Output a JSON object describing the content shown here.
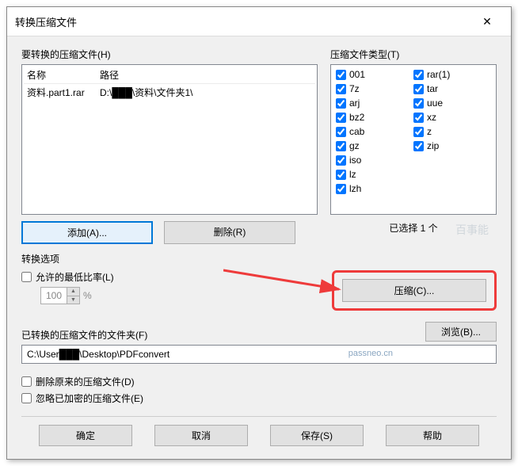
{
  "title": "转换压缩文件",
  "filesSection": {
    "label": "要转换的压缩文件(H)",
    "colName": "名称",
    "colPath": "路径",
    "row": {
      "name": "资料.part1.rar",
      "path": "D:\\███\\资料\\文件夹1\\"
    }
  },
  "typesSection": {
    "label": "压缩文件类型(T)",
    "col1": [
      "001",
      "7z",
      "arj",
      "bz2",
      "cab",
      "gz",
      "iso",
      "lz",
      "lzh"
    ],
    "col2": [
      "rar(1)",
      "tar",
      "uue",
      "xz",
      "z",
      "zip"
    ],
    "selectedNote": "已选择 1 个"
  },
  "buttons": {
    "add": "添加(A)...",
    "delete": "删除(R)",
    "compress": "压缩(C)...",
    "browse": "浏览(B)...",
    "ok": "确定",
    "cancel": "取消",
    "save": "保存(S)",
    "help": "帮助"
  },
  "options": {
    "label": "转换选项",
    "minRatioLabel": "允许的最低比率(L)",
    "minRatioValue": "100",
    "percent": "%"
  },
  "folder": {
    "label": "已转换的压缩文件的文件夹(F)",
    "path": "C:\\User███\\Desktop\\PDFconvert",
    "watermark": "passneo.cn"
  },
  "bottomChecks": {
    "deleteOriginal": "删除原来的压缩文件(D)",
    "ignoreEncrypted": "忽略已加密的压缩文件(E)"
  },
  "bgWatermark": "百事能"
}
